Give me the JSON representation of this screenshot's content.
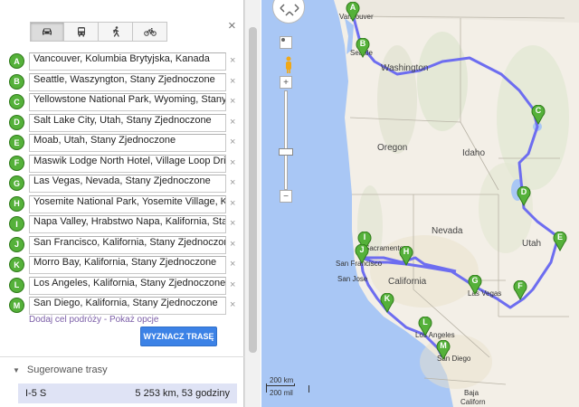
{
  "panel": {
    "close_symbol": "×",
    "modes": [
      {
        "name": "car",
        "icon": "car-icon",
        "active": true
      },
      {
        "name": "transit",
        "icon": "bus-icon",
        "active": false
      },
      {
        "name": "walking",
        "icon": "walk-icon",
        "active": false
      },
      {
        "name": "bicycle",
        "icon": "bicycle-icon",
        "active": false
      }
    ],
    "stops": [
      {
        "letter": "A",
        "value": "Vancouver, Kolumbia Brytyjska, Kanada"
      },
      {
        "letter": "B",
        "value": "Seattle, Waszyngton, Stany Zjednoczone"
      },
      {
        "letter": "C",
        "value": "Yellowstone National Park, Wyoming, Stany Z"
      },
      {
        "letter": "D",
        "value": "Salt Lake City, Utah, Stany Zjednoczone"
      },
      {
        "letter": "E",
        "value": "Moab, Utah, Stany Zjednoczone"
      },
      {
        "letter": "F",
        "value": "Maswik Lodge North Hotel, Village Loop Drive"
      },
      {
        "letter": "G",
        "value": "Las Vegas, Nevada, Stany Zjednoczone"
      },
      {
        "letter": "H",
        "value": "Yosemite National Park, Yosemite Village, Kal"
      },
      {
        "letter": "I",
        "value": "Napa Valley, Hrabstwo Napa, Kalifornia, Stany"
      },
      {
        "letter": "J",
        "value": "San Francisco, Kalifornia, Stany Zjednoczone"
      },
      {
        "letter": "K",
        "value": "Morro Bay, Kalifornia, Stany Zjednoczone"
      },
      {
        "letter": "L",
        "value": "Los Angeles, Kalifornia, Stany Zjednoczone"
      },
      {
        "letter": "M",
        "value": "San Diego, Kalifornia, Stany Zjednoczone"
      }
    ],
    "remove_symbol": "×",
    "add_destination": "Dodaj cel podróży",
    "separator": " - ",
    "show_options": "Pokaż opcje",
    "route_button": "WYZNACZ TRASĘ",
    "suggested_routes_label": "Sugerowane trasy",
    "route": {
      "name": "I-5 S",
      "summary": "5 253 km, 53 godziny"
    }
  },
  "map": {
    "colors": {
      "route": "#6d6df0",
      "pin": "#55b13a",
      "water": "#a9c7f5",
      "land": "#f3efe7"
    },
    "labels": {
      "vancouver": "Vancouver",
      "seattle": "Seattle",
      "washington": "Washington",
      "oregon": "Oregon",
      "idaho": "Idaho",
      "nevada": "Nevada",
      "utah": "Utah",
      "california": "California",
      "sacramento": "Sacramento",
      "san_francisco": "San Francisco",
      "san_jose": "San Jose",
      "las_vegas": "Las Vegas",
      "los_angeles": "Los Angeles",
      "san_diego": "San Diego",
      "baja": "Baja",
      "california_bottom": "Californ"
    },
    "zoom_in": "+",
    "zoom_out": "−",
    "scale_km": "200 km",
    "scale_mi": "200 mil"
  }
}
